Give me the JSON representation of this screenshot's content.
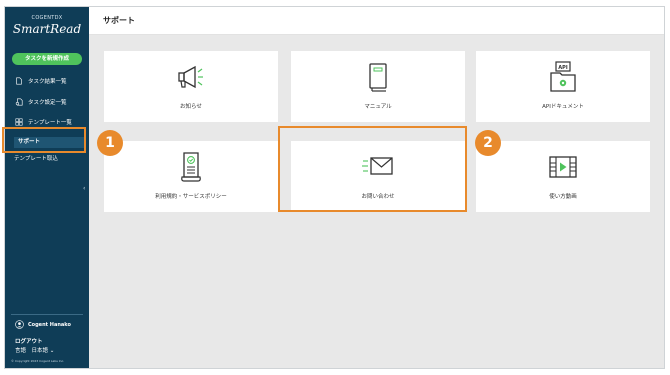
{
  "brand": {
    "top": "COGENTDX",
    "main": "SmartRead"
  },
  "sidebar": {
    "create_button": "タスクを新規作成",
    "items": [
      {
        "label": "タスク結果一覧",
        "icon": "document-icon"
      },
      {
        "label": "タスク設定一覧",
        "icon": "document-gear-icon"
      },
      {
        "label": "テンプレート一覧",
        "icon": "template-grid-icon"
      }
    ],
    "support": "サポート",
    "import": "テンプレート取込",
    "collapse": "‹",
    "user_name": "Cogent Hanako",
    "logout": "ログアウト",
    "language": "言語　日本語 ⌄",
    "copyright": "© Copyright 2023 Cogent Labs Inc."
  },
  "header": {
    "title": "サポート"
  },
  "cards": [
    {
      "label": "お知らせ",
      "icon": "megaphone-icon"
    },
    {
      "label": "マニュアル",
      "icon": "manual-book-icon"
    },
    {
      "label": "APIドキュメント",
      "icon": "api-document-icon"
    },
    {
      "label": "利用規約・サービスポリシー",
      "icon": "terms-scroll-icon"
    },
    {
      "label": "お問い合わせ",
      "icon": "mail-icon"
    },
    {
      "label": "使い方動画",
      "icon": "video-icon"
    }
  ],
  "badges": [
    "1",
    "2"
  ],
  "colors": {
    "sidebar": "#0f3d57",
    "accent_green": "#4fc35c",
    "highlight": "#e88a2c",
    "background": "#e8e8e8"
  }
}
